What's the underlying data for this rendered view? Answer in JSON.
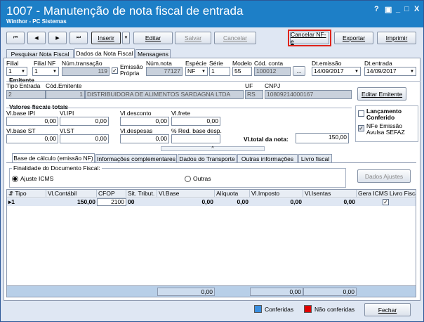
{
  "window": {
    "title": "1007 - Manutenção de nota fiscal de entrada",
    "subtitle": "Winthor - PC Sistemas",
    "controls": [
      "?",
      "▣",
      "_",
      "□",
      "X"
    ]
  },
  "toolbar": {
    "first": "⏮",
    "prev": "◀",
    "next": "▶",
    "last": "⏭",
    "insert": "Inserir",
    "edit": "Editar",
    "save": "Salvar",
    "cancel": "Cancelar",
    "cancel_nfe": "Cancelar NF-e",
    "export": "Exportar",
    "print": "Imprimir"
  },
  "main_tabs": [
    "Pesquisar Nota Fiscal",
    "Dados da Nota Fiscal",
    "Mensagens"
  ],
  "header": {
    "filial_label": "Filial",
    "filial": "1",
    "filial_nf_label": "Filial NF",
    "filial_nf": "1",
    "num_transacao_label": "Núm.transação",
    "num_transacao": "119",
    "emissao_propria_label": "Emissão Própria",
    "emissao_propria_check": "✓",
    "num_nota_label": "Núm.nota",
    "num_nota": "77127",
    "especie_label": "Espécie",
    "especie": "NF",
    "serie_label": "Série",
    "serie": "1",
    "modelo_label": "Modelo",
    "modelo": "55",
    "cod_conta_label": "Cód. conta",
    "cod_conta": "100012",
    "ellipsis": "...",
    "dt_emissao_label": "Dt.emissão",
    "dt_emissao": "14/09/2017",
    "dt_entrada_label": "Dt.entrada",
    "dt_entrada": "14/09/2017"
  },
  "emitente": {
    "section": "Emitente",
    "tipo_entrada_label": "Tipo Entrada",
    "tipo_entrada": "2",
    "cod_emitente_label": "Cód.Emitente",
    "cod_emitente": "1",
    "nome": "DISTRIBUIDORA DE ALIMENTOS SARDAGNA LTDA",
    "uf_label": "UF",
    "uf": "RS",
    "cnpj_label": "CNPJ",
    "cnpj": "10809214000167",
    "edit_button": "Editar Emitente"
  },
  "valores": {
    "section": "Valores fiscais totais",
    "base_ipi_label": "Vl.base IPI",
    "base_ipi": "0,00",
    "ipi_label": "Vl.IPI",
    "ipi": "0,00",
    "desconto_label": "Vl.desconto",
    "desconto": "0,00",
    "frete_label": "Vl.frete",
    "frete": "0,00",
    "base_st_label": "Vl.base ST",
    "base_st": "0,00",
    "st_label": "Vl.ST",
    "st": "0,00",
    "despesas_label": "Vl.despesas",
    "despesas": "0,00",
    "red_base_label": "% Red. base desp.",
    "red_base": "",
    "total_label": "Vl.total da nota:",
    "total": "150,00"
  },
  "flags": {
    "lancamento": "Lançamento Conferido",
    "nfe_avulsa": "NFe Emissão Avulsa SEFAZ",
    "nfe_avulsa_check": "✓"
  },
  "splitter": "^",
  "sub_tabs": [
    "Base de cálculo (emissão NF)",
    "Informações complementares",
    "Dados do Transporte",
    "Outras informações",
    "Livro fiscal"
  ],
  "finalidade": {
    "label": "Finalidade do Documento Fiscal:",
    "opt1": "Ajuste ICMS",
    "opt2": "Outras",
    "dados_ajustes": "Dados Ajustes"
  },
  "grid": {
    "headers": [
      "Tipo",
      "Vl.Contábil",
      "CFOP",
      "Sit. Tribut.",
      "Vl.Base",
      "Alíquota",
      "Vl.Imposto",
      "Vl.Isentas",
      "Gera ICMS Livro Fiscal"
    ],
    "row": {
      "tipo": "1",
      "contabil": "150,00",
      "cfop": "2100",
      "sit": "00",
      "base": "0,00",
      "aliquota": "0,00",
      "imposto": "0,00",
      "isentas": "0,00",
      "gera": "✓"
    },
    "totals": {
      "base": "0,00",
      "imposto": "0,00",
      "isentas": "0,00"
    }
  },
  "footer": {
    "conferidas": "Conferidas",
    "nao_conferidas": "Não conferidas",
    "close": "Fechar"
  },
  "colors": {
    "titlebar": "#1d7fc7",
    "conferidas": "#3b8fe0",
    "nao_conferidas": "#e00000",
    "highlight": "#e0241b"
  }
}
